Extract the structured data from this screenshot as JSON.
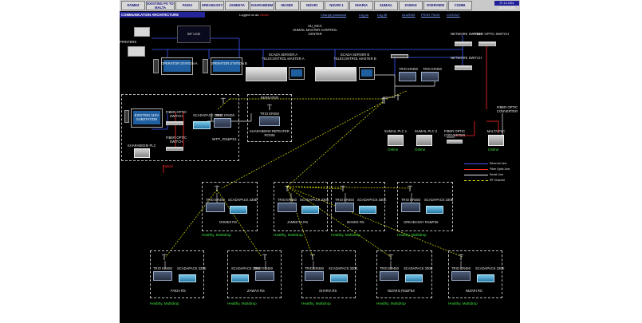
{
  "nav": {
    "buttons": [
      {
        "id": "domez",
        "label": "DOMEZ"
      },
      {
        "id": "existing",
        "label": "EXISTING PS TO MALTA"
      },
      {
        "id": "faida",
        "label": "FAIDA"
      },
      {
        "id": "greabassy",
        "label": "GREABASSY"
      },
      {
        "id": "jameeya",
        "label": "JAMEEYA"
      },
      {
        "id": "kharabeem",
        "label": "KHARABEEM"
      },
      {
        "id": "masek",
        "label": "MASEK"
      },
      {
        "id": "nizari",
        "label": "NIZARI"
      },
      {
        "id": "nizari1",
        "label": "NIZARI 1"
      },
      {
        "id": "sharia",
        "label": "SHARIA"
      },
      {
        "id": "sumail",
        "label": "SUMAIL"
      },
      {
        "id": "zawah",
        "label": "ZAWAH"
      },
      {
        "id": "overview",
        "label": "OVERVIEW"
      },
      {
        "id": "comm",
        "label": "COMM."
      }
    ],
    "datetime": "27-12-2011 16:46:03.291"
  },
  "subbar": {
    "title": "COMMUNICATION ARCHITECTURE",
    "logged_in_as": "Logged on as:",
    "user": "Guest",
    "change_password": "Change password",
    "log_on": "Log on",
    "log_off": "Log off",
    "alarms": "ALARMS",
    "print_page": "PRINT PAGE",
    "logout": "LOGOUT"
  },
  "control_center": {
    "lcd": "55\" LCD",
    "title_line1": "SU_MCC",
    "title_line2": "SUMAIL MASTER CONTROL",
    "title_line3": "CENTER",
    "printers": "PRINTERS",
    "operator_a": "OPERATOR STATION A",
    "operator_b": "OPERATOR STATION B",
    "server_a_line1": "SCADA SERVER A",
    "server_a_line2": "TELECONTROL MASTER A",
    "server_b_line1": "SCADA SERVER B",
    "server_b_line2": "TELECONTROL MASTER B",
    "network_switch_1": "NETWORK SWITCH",
    "network_switch_2": "NETWORK SWITCH",
    "fiber_switch_top": "FIBER OPTIC SWITCH",
    "fiber_converter": "FIBER OPTIC CONVERTER",
    "trio_a": "TRIO ER450",
    "trio_b": "TRIO ER450"
  },
  "substation": {
    "existing": "EXISTING 11KV SUBSTATION",
    "fiber_switch_1": "FIBER OPTIC SWITCH",
    "fiber_switch_2": "FIBER OPTIC SWITCH",
    "kharabeem_plc": "KHARABEEM PLC",
    "scadapack": "SCADAPACK 330E",
    "trio": "TRIO ER450",
    "name": "WTP_RS&PS1",
    "status": "Failed"
  },
  "repeater": {
    "title": "REPEATER",
    "trio": "TRIO ER450",
    "room": "KHARABEEM REPEATER ROOM"
  },
  "plcs": [
    {
      "label": "SUMAIL PLC 1",
      "status": "Online"
    },
    {
      "label": "SUMAIL PLC 2",
      "status": "Online"
    },
    {
      "label": "MALTA PLC",
      "status": "Online"
    }
  ],
  "legend": [
    {
      "label": "Ethernet Line",
      "color": "#3b5bff"
    },
    {
      "label": "Fiber Optic Line",
      "color": "#ff2a2a"
    },
    {
      "label": "Serial Line",
      "color": "#e6e6e6"
    },
    {
      "label": "RF Channel",
      "color": "#e6e600"
    }
  ],
  "stations_row1": [
    {
      "name": "DOMEZ RS",
      "status": "Healthy, Multidrop",
      "scadapack": "SCADAPACK 330E",
      "trio": "TRIO ER450"
    },
    {
      "name": "JAMEEYA RS",
      "status": "Healthy, Multidrop",
      "scadapack": "SCADAPACK 330E",
      "trio": "TRIO ER450"
    },
    {
      "name": "MASEK RS",
      "status": "Healthy, Multidrop",
      "scadapack": "SCADAPACK 330E",
      "trio": "TRIO ER450"
    },
    {
      "name": "GREABASSY RS&PS5",
      "status": "Healthy, Multidrop",
      "scadapack": "SCADAPACK 330E",
      "trio": "TRIO ER450"
    }
  ],
  "stations_row2": [
    {
      "name": "FAIDA RS",
      "status": "Healthy, Multidrop",
      "scadapack": "SCADAPACK 330E",
      "trio": "TRIO ER450"
    },
    {
      "name": "ZAWAH RS",
      "status": "Healthy, Multidrop",
      "scadapack": "SCADAPACK 330E",
      "trio": "TRIO ER450"
    },
    {
      "name": "SHARIA RS",
      "status": "Healthy, Multidrop",
      "scadapack": "SCADAPACK 330E",
      "trio": "TRIO ER450"
    },
    {
      "name": "NIZARI1 RS&PS4",
      "status": "Healthy, Multidrop",
      "scadapack": "SCADAPACK 330E",
      "trio": "TRIO ER450"
    },
    {
      "name": "NIZARI RS",
      "status": "Healthy, Multidrop",
      "scadapack": "SCADAPACK 330E",
      "trio": "TRIO ER450"
    }
  ]
}
